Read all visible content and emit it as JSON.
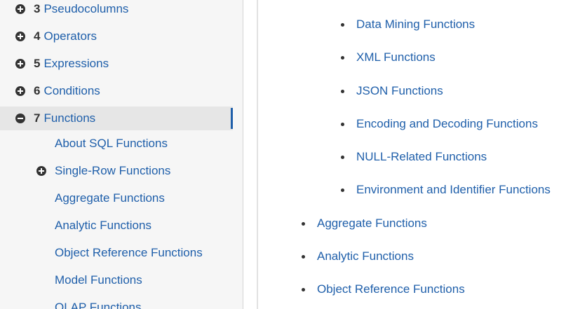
{
  "sidebar": {
    "items": [
      {
        "num": "3",
        "label": "Pseudocolumns",
        "toggle": "plus",
        "active": false
      },
      {
        "num": "4",
        "label": "Operators",
        "toggle": "plus",
        "active": false
      },
      {
        "num": "5",
        "label": "Expressions",
        "toggle": "plus",
        "active": false
      },
      {
        "num": "6",
        "label": "Conditions",
        "toggle": "plus",
        "active": false
      },
      {
        "num": "7",
        "label": "Functions",
        "toggle": "minus",
        "active": true
      }
    ],
    "subitems": [
      {
        "label": "About SQL Functions",
        "toggle": "none"
      },
      {
        "label": "Single-Row Functions",
        "toggle": "plus"
      },
      {
        "label": "Aggregate Functions",
        "toggle": "none"
      },
      {
        "label": "Analytic Functions",
        "toggle": "none"
      },
      {
        "label": "Object Reference Functions",
        "toggle": "none"
      },
      {
        "label": "Model Functions",
        "toggle": "none"
      },
      {
        "label": "OLAP Functions",
        "toggle": "none"
      }
    ]
  },
  "main": {
    "nested_links": [
      "Data Mining Functions",
      "XML Functions",
      "JSON Functions",
      "Encoding and Decoding Functions",
      "NULL-Related Functions",
      "Environment and Identifier Functions"
    ],
    "top_links": [
      "Aggregate Functions",
      "Analytic Functions",
      "Object Reference Functions"
    ]
  },
  "colors": {
    "link": "#1f5faa",
    "text": "#333333",
    "sidebar_bg": "#f6f6f6",
    "active_bg": "#e6e6e6"
  }
}
